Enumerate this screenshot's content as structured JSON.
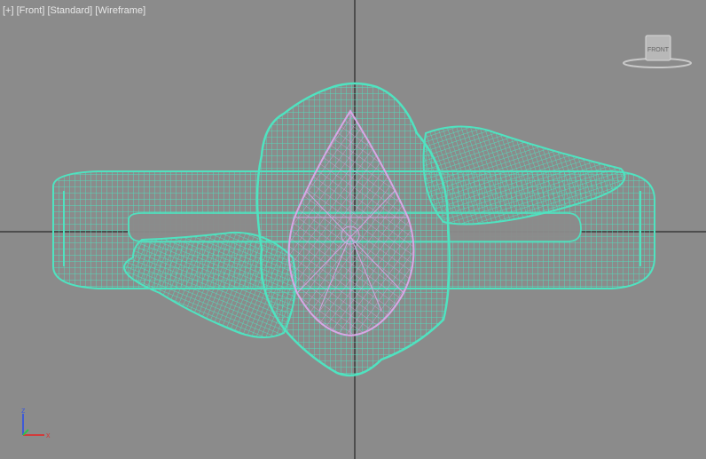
{
  "viewport": {
    "labels": {
      "plus": "[+]",
      "view": "[Front]",
      "shading_mode": "[Standard]",
      "render_mode": "[Wireframe]"
    },
    "viewcube": {
      "face_label": "FRONT"
    },
    "axis_gizmo": {
      "z_label": "z",
      "x_label": "x"
    }
  },
  "colors": {
    "background": "#8b8b8b",
    "wireframe_band": "#4fe3c0",
    "wireframe_gem": "#d8a6e6",
    "axis_lines": "#111111",
    "axis_z": "#3f5bd6",
    "axis_x": "#d23b3b",
    "axis_y": "#2fbf4a"
  }
}
